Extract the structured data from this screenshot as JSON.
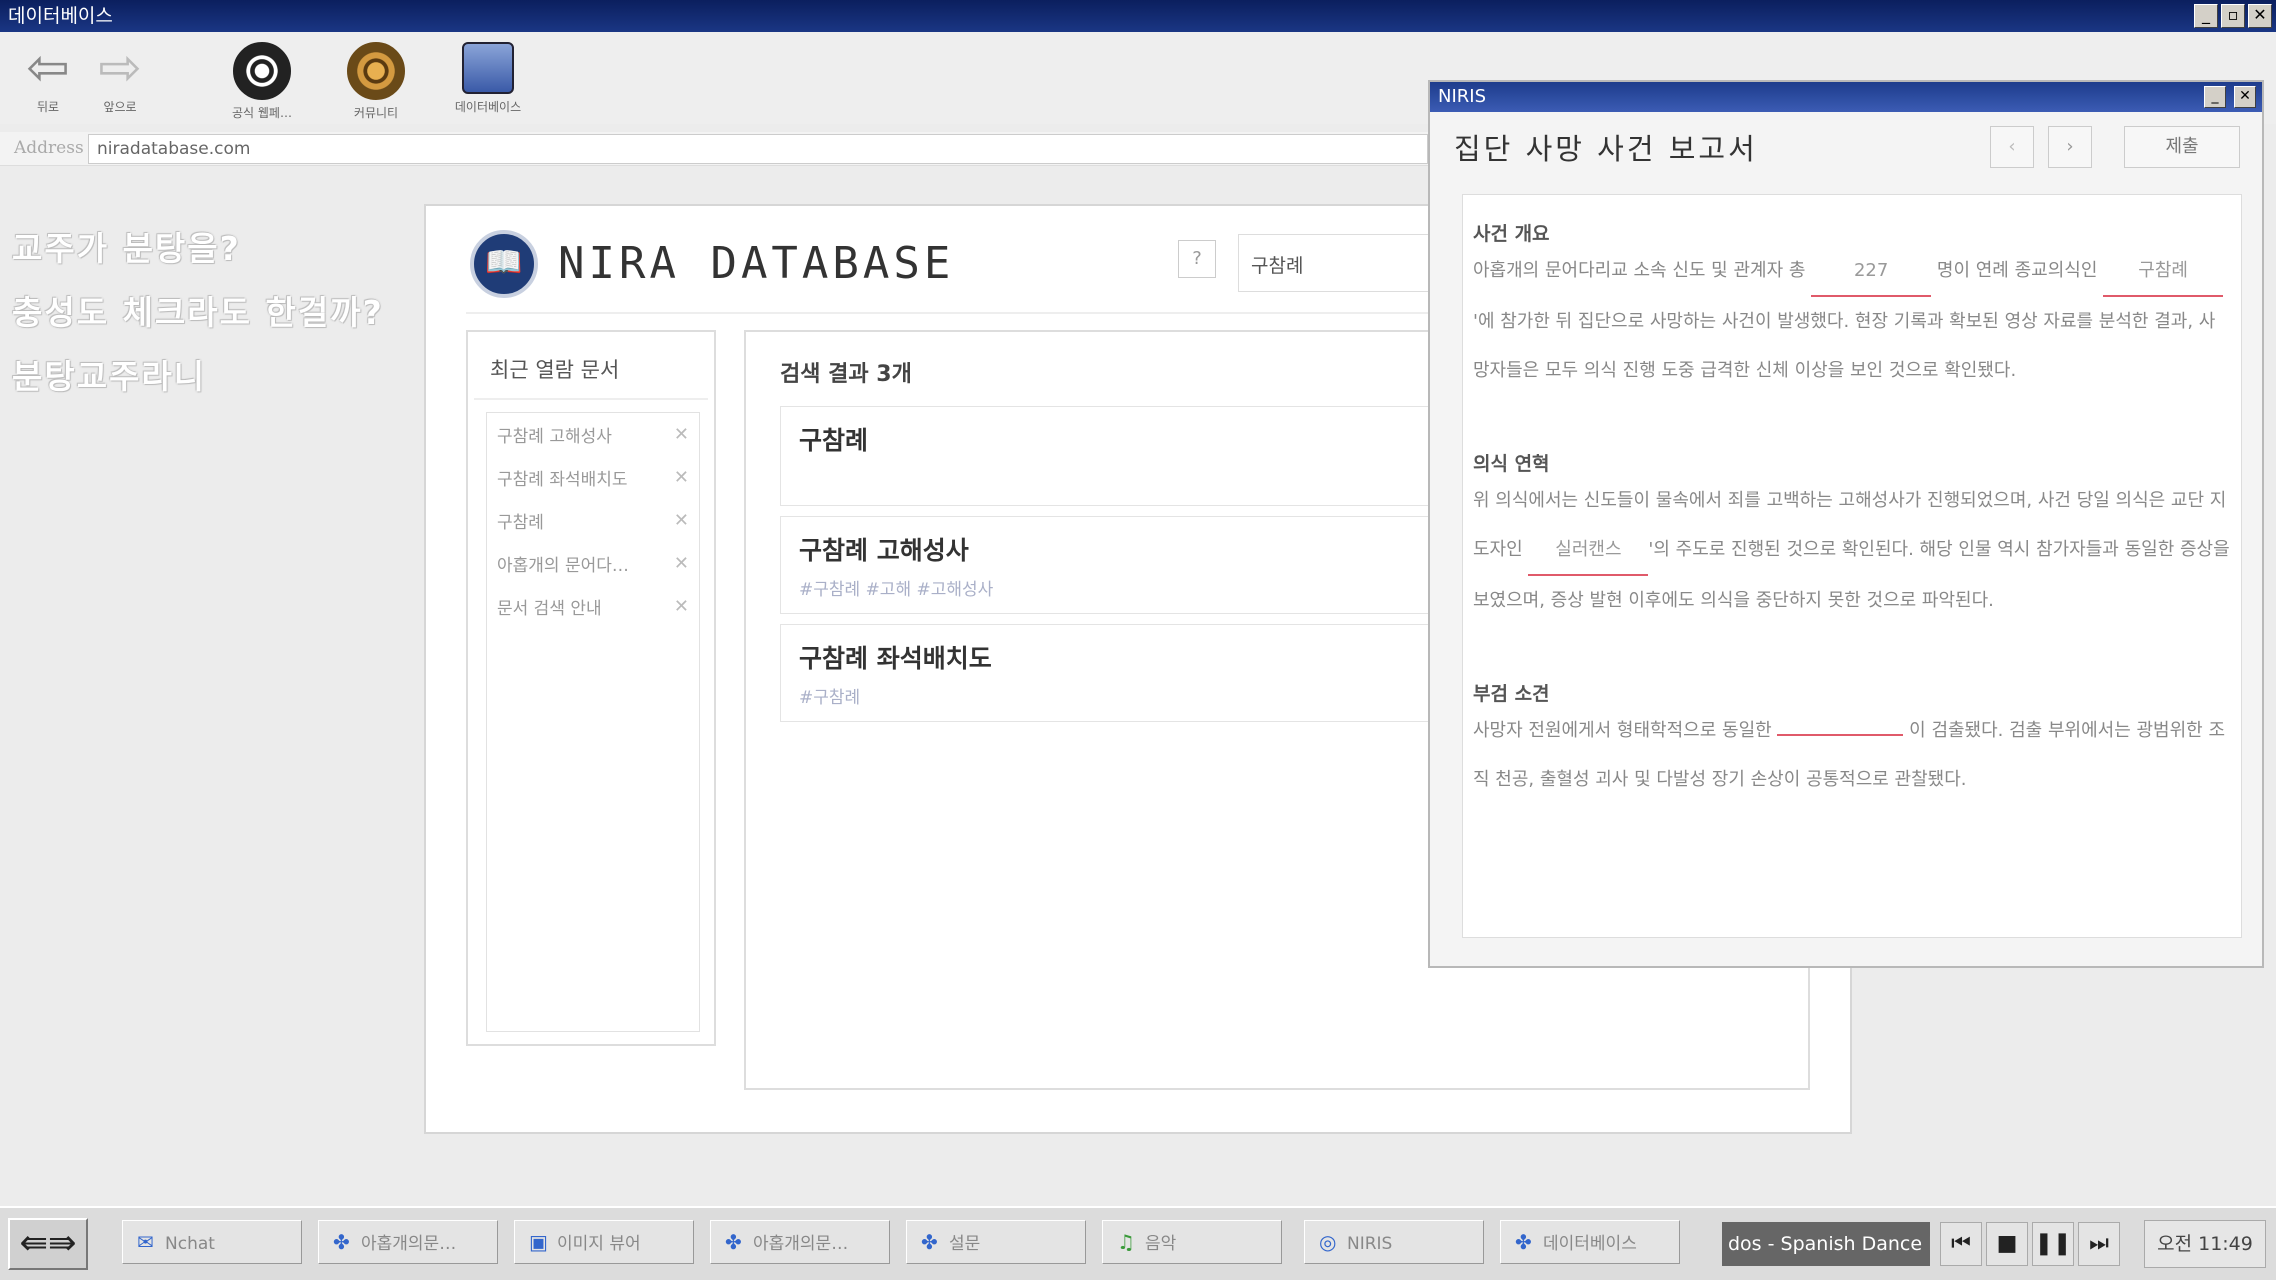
{
  "window": {
    "title": "데이터베이스"
  },
  "toolbar": {
    "back_label": "뒤로",
    "forward_label": "앞으로",
    "official_label": "공식 웹페…",
    "community_label": "커뮤니티",
    "database_label": "데이터베이스"
  },
  "address": {
    "label": "Address",
    "url": "niradatabase.com"
  },
  "desktop_notes": [
    "교주가 분탕을?",
    "충성도 체크라도 한걸까?",
    "분탕교주라니"
  ],
  "db": {
    "title": "NIRA DATABASE",
    "help": "?",
    "search_value": "구참례",
    "recent_title": "최근 열람 문서",
    "recent_items": [
      "구참례 고해성사",
      "구참례 좌석배치도",
      "구참례",
      "아홉개의 문어다…",
      "문서 검색 안내"
    ],
    "results_title": "검색 결과 3개",
    "results": [
      {
        "title": "구참례",
        "tags": ""
      },
      {
        "title": "구참례 고해성사",
        "tags": "#구참례  #고해  #고해성사"
      },
      {
        "title": "구참례 좌석배치도",
        "tags": "#구참례"
      }
    ]
  },
  "niris": {
    "window_title": "NIRIS",
    "report_title": "집단 사망 사건 보고서",
    "prev": "‹",
    "next": "›",
    "submit": "제출",
    "s1_heading": "사건 개요",
    "s1_a": "아홉개의 문어다리교 소속 신도 및 관계자 총",
    "s1_fill1": "227",
    "s1_b": "명이 연례 종교의식인",
    "s1_fill2": "구참례",
    "s1_c": "'에 참가한 뒤 집단으로 사망하는 사건이 발생했다. 현장 기록과 확보된 영상 자료를 분석한 결과, 사망자들은 모두 의식 진행 도중 급격한 신체 이상을 보인 것으로 확인됐다.",
    "s2_heading": "의식 연혁",
    "s2_a": "위 의식에서는 신도들이 물속에서 죄를 고백하는 고해성사가 진행되었으며, 사건 당일 의식은 교단 지도자인",
    "s2_fill": "실러캔스",
    "s2_b": "'의 주도로 진행된 것으로 확인된다. 해당 인물 역시 참가자들과 동일한 증상을 보였으며, 증상 발현 이후에도 의식을 중단하지 못한 것으로 파악된다.",
    "s3_heading": "부검 소견",
    "s3_a": "사망자 전원에게서 형태학적으로 동일한",
    "s3_fill": "",
    "s3_b": "이 검출됐다. 검출 부위에서는 광범위한 조직 천공, 출혈성 괴사 및 다발성 장기 손상이 공통적으로 관찰됐다."
  },
  "taskbar": {
    "tasks": [
      "Nchat",
      "아홉개의문…",
      "이미지 뷰어",
      "아홉개의문…",
      "설문",
      "음악",
      "NIRIS",
      "데이터베이스"
    ],
    "music": "dos - Spanish Dance N",
    "clock": "오전 11:49"
  }
}
